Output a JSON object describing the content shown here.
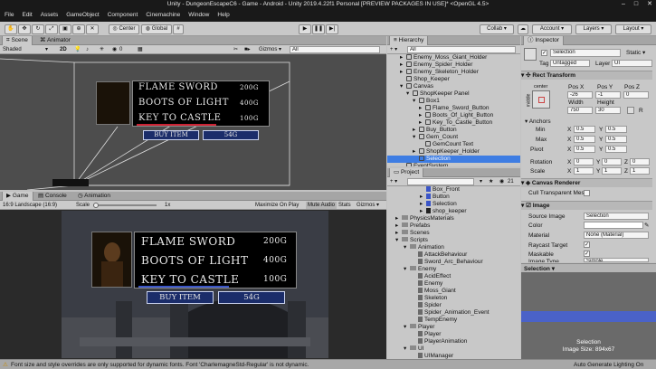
{
  "window": {
    "title": "Unity - DungeonEscapeC6 - Game - Android - Unity 2019.4.22f1 Personal [PREVIEW PACKAGES IN USE]* <OpenGL 4.5>",
    "minimize": "–",
    "maximize": "□",
    "close": "✕"
  },
  "menu": [
    "File",
    "Edit",
    "Assets",
    "GameObject",
    "Component",
    "Cinemachine",
    "Window",
    "Help"
  ],
  "toolbar": {
    "center": "Center",
    "global": "Global",
    "collab": "Collab ▾",
    "account": "Account ▾",
    "layers": "Layers ▾",
    "layout": "Layout ▾"
  },
  "scene": {
    "tabs": [
      "Scene",
      "Animator"
    ],
    "shading": "Shaded",
    "mode2d": "2D",
    "gizmos": "Gizmos ▾",
    "search": "All",
    "zero": "0"
  },
  "game": {
    "tabs": [
      "Game",
      "Console",
      "Animation"
    ],
    "aspect": "16:9 Landscape (16:9)",
    "scale_label": "Scale",
    "scale_value": "1x",
    "options": [
      "Maximize On Play",
      "Mute Audio",
      "Stats",
      "Gizmos ▾"
    ]
  },
  "shop": {
    "items": [
      {
        "name": "FLAME SWORD",
        "price": "200G"
      },
      {
        "name": "BOOTS OF LIGHT",
        "price": "400G"
      },
      {
        "name": "KEY TO CASTLE",
        "price": "100G"
      }
    ],
    "buy_label": "BUY ITEM",
    "gems": "54G",
    "scene_gems": "54G"
  },
  "hierarchy": {
    "tab": "Hierarchy",
    "create": "+ ▾",
    "search": "All",
    "items": [
      {
        "label": "Enemy_Moss_Giant_Holder",
        "depth": 2,
        "arrow": "▸"
      },
      {
        "label": "Enemy_Spider_Holder",
        "depth": 2,
        "arrow": "▸"
      },
      {
        "label": "Enemy_Skeleton_Holder",
        "depth": 2,
        "arrow": "▸"
      },
      {
        "label": "Shop_Keeper",
        "depth": 2,
        "arrow": ""
      },
      {
        "label": "Canvas",
        "depth": 2,
        "arrow": "▾"
      },
      {
        "label": "ShopKeeper Panel",
        "depth": 3,
        "arrow": "▾"
      },
      {
        "label": "Box1",
        "depth": 4,
        "arrow": "▾"
      },
      {
        "label": "Flame_Sword_Button",
        "depth": 5,
        "arrow": "▸"
      },
      {
        "label": "Boots_Of_Light_Button",
        "depth": 5,
        "arrow": "▸"
      },
      {
        "label": "Key_To_Castle_Button",
        "depth": 5,
        "arrow": "▸"
      },
      {
        "label": "Buy_Button",
        "depth": 4,
        "arrow": "▸"
      },
      {
        "label": "Gem_Count",
        "depth": 4,
        "arrow": "▾"
      },
      {
        "label": "GemCount Text",
        "depth": 5,
        "arrow": ""
      },
      {
        "label": "ShopKeeper_Holder",
        "depth": 4,
        "arrow": "▸"
      },
      {
        "label": "Selection",
        "depth": 4,
        "arrow": "",
        "selected": true
      },
      {
        "label": "EventSystem",
        "depth": 2,
        "arrow": ""
      }
    ]
  },
  "project": {
    "tab": "Project",
    "create": "+ ▾",
    "count": "21",
    "items": [
      {
        "label": "Box_Front",
        "depth": 4,
        "kind": "file"
      },
      {
        "label": "Button",
        "depth": 4,
        "kind": "file",
        "arrow": "▸"
      },
      {
        "label": "Selection",
        "depth": 4,
        "kind": "file",
        "arrow": "▸"
      },
      {
        "label": "shop_keeper",
        "depth": 4,
        "kind": "img",
        "arrow": "▸"
      },
      {
        "label": "PhysicsMaterials",
        "depth": 1,
        "kind": "folder",
        "arrow": "▸"
      },
      {
        "label": "Prefabs",
        "depth": 1,
        "kind": "folder",
        "arrow": "▸"
      },
      {
        "label": "Scenes",
        "depth": 1,
        "kind": "folder",
        "arrow": "▸"
      },
      {
        "label": "Scripts",
        "depth": 1,
        "kind": "folder",
        "arrow": "▾"
      },
      {
        "label": "Animation",
        "depth": 2,
        "kind": "folder",
        "arrow": "▾"
      },
      {
        "label": "AttackBehaviour",
        "depth": 3,
        "kind": "script"
      },
      {
        "label": "Sword_Arc_Behaviour",
        "depth": 3,
        "kind": "script"
      },
      {
        "label": "Enemy",
        "depth": 2,
        "kind": "folder",
        "arrow": "▾"
      },
      {
        "label": "AcidEffect",
        "depth": 3,
        "kind": "script"
      },
      {
        "label": "Enemy",
        "depth": 3,
        "kind": "script"
      },
      {
        "label": "Moss_Giant",
        "depth": 3,
        "kind": "script"
      },
      {
        "label": "Skeleton",
        "depth": 3,
        "kind": "script"
      },
      {
        "label": "Spider",
        "depth": 3,
        "kind": "script"
      },
      {
        "label": "Spider_Animation_Event",
        "depth": 3,
        "kind": "script"
      },
      {
        "label": "TempEnemy",
        "depth": 3,
        "kind": "script"
      },
      {
        "label": "Player",
        "depth": 2,
        "kind": "folder",
        "arrow": "▾"
      },
      {
        "label": "Player",
        "depth": 3,
        "kind": "script"
      },
      {
        "label": "PlayerAnimation",
        "depth": 3,
        "kind": "script"
      },
      {
        "label": "UI",
        "depth": 2,
        "kind": "folder",
        "arrow": "▾"
      },
      {
        "label": "UIManager",
        "depth": 3,
        "kind": "script"
      }
    ]
  },
  "inspector": {
    "tab": "Inspector",
    "name": "Selection",
    "static": "Static ▾",
    "tag_label": "Tag",
    "tag": "Untagged",
    "layer_label": "Layer",
    "layer": "UI",
    "rect": {
      "title": "Rect Transform",
      "anchor_h": "center",
      "anchor_v": "middle",
      "posx_label": "Pos X",
      "posy_label": "Pos Y",
      "posz_label": "Pos Z",
      "posx": "-26",
      "posy": "-1",
      "posz": "0",
      "width_label": "Width",
      "height_label": "Height",
      "width": "750",
      "height": "30",
      "r": "R",
      "anchors": "Anchors",
      "min": "Min",
      "max": "Max",
      "pivot": "Pivot",
      "min_x": "0.5",
      "min_y": "0.5",
      "max_x": "0.5",
      "max_y": "0.5",
      "pivot_x": "0.5",
      "pivot_y": "0.5",
      "rotation": "Rotation",
      "scale": "Scale",
      "rx": "0",
      "ry": "0",
      "rz": "0",
      "sx": "1",
      "sy": "1",
      "sz": "1"
    },
    "canvas_renderer": {
      "title": "Canvas Renderer",
      "cull": "Cull Transparent Mes"
    },
    "image": {
      "title": "Image",
      "source_label": "Source Image",
      "source": "Selection",
      "color_label": "Color",
      "material_label": "Material",
      "material": "None (Material)",
      "raycast": "Raycast Target",
      "maskable": "Maskable",
      "type_label": "Image Type",
      "type": "Simple"
    },
    "preview": {
      "label": "Selection ▾",
      "name": "Selection",
      "size": "Image Size: 894x67"
    }
  },
  "status": {
    "warning": "Font size and style overrides are only supported for dynamic fonts. Font 'CharlemagneStd-Regular' is not dynamic.",
    "right": "Auto Generate Lighting On"
  },
  "colors": {
    "selection": "#3e7de3",
    "title_bg": "#191919",
    "game_bg": "#2a2a2a",
    "preview": "#4a62c8"
  }
}
